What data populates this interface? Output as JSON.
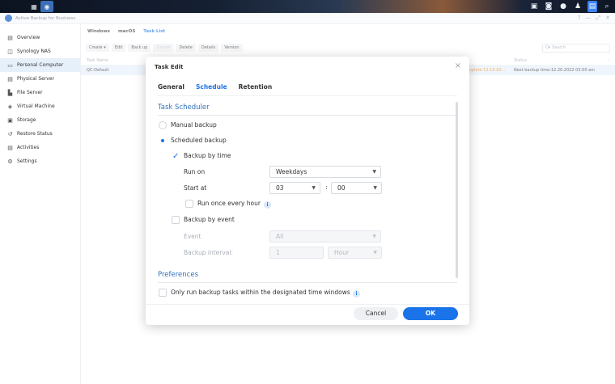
{
  "taskbar": {
    "grid_icon": "grid-icon",
    "app_icon": "active-backup-icon",
    "right_icons": [
      "package-icon",
      "user-icon",
      "notification-icon",
      "person-icon",
      "window-icon",
      "search-icon"
    ]
  },
  "app": {
    "name": "Active Backup for Business",
    "controls": [
      "?",
      "—",
      "⤢",
      "✕"
    ]
  },
  "sidebar": {
    "items": [
      {
        "label": "Overview",
        "icon": "overview-icon",
        "glyph": "▤"
      },
      {
        "label": "Synology NAS",
        "icon": "nas-icon",
        "glyph": "◫"
      },
      {
        "label": "Personal Computer",
        "icon": "computer-icon",
        "glyph": "▭"
      },
      {
        "label": "Physical Server",
        "icon": "server-icon",
        "glyph": "▤"
      },
      {
        "label": "File Server",
        "icon": "file-server-icon",
        "glyph": "▙"
      },
      {
        "label": "Virtual Machine",
        "icon": "virtual-machine-icon",
        "glyph": "◈"
      },
      {
        "label": "Storage",
        "icon": "storage-icon",
        "glyph": "▣"
      },
      {
        "label": "Restore Status",
        "icon": "restore-icon",
        "glyph": "↺"
      },
      {
        "label": "Activities",
        "icon": "activities-icon",
        "glyph": "▤"
      },
      {
        "label": "Settings",
        "icon": "settings-icon",
        "glyph": "⚙"
      }
    ]
  },
  "main": {
    "tabs": [
      "Windows",
      "macOS",
      "Task List"
    ],
    "toolbar": {
      "create": "Create ▾",
      "edit": "Edit",
      "backup": "Back up",
      "cancel": "Cancel",
      "delete": "Delete",
      "details": "Details",
      "version": "Version"
    },
    "search_placeholder": "Q▾ Search",
    "table": {
      "headers": {
        "task_name": "Task Name",
        "status": "Status"
      },
      "rows": [
        {
          "task_name": "QC-Default",
          "date": "mplete 12.19.20...",
          "status": "Next backup time:12.20.2022 03:00 am"
        }
      ]
    }
  },
  "dialog": {
    "title": "Task Edit",
    "close": "×",
    "tabs": [
      "General",
      "Schedule",
      "Retention"
    ],
    "task_scheduler": {
      "title": "Task Scheduler",
      "manual_backup": "Manual backup",
      "scheduled_backup": "Scheduled backup",
      "backup_by_time": "Backup by time",
      "run_on_label": "Run on",
      "run_on_value": "Weekdays",
      "start_at_label": "Start at",
      "start_hour": "03",
      "start_minute": "00",
      "run_once_every_hour": "Run once every hour",
      "backup_by_event": "Backup by event",
      "event_label": "Event",
      "event_value": "All",
      "backup_interval_label": "Backup interval:",
      "backup_interval_value": "1",
      "backup_interval_unit": "Hour"
    },
    "preferences": {
      "title": "Preferences",
      "only_run_within_windows": "Only run backup tasks within the designated time windows"
    },
    "buttons": {
      "cancel": "Cancel",
      "ok": "OK"
    }
  },
  "colors": {
    "accent": "#1a73e8",
    "section_title": "#2f74c0",
    "selection_bg": "#e6f0fb"
  }
}
